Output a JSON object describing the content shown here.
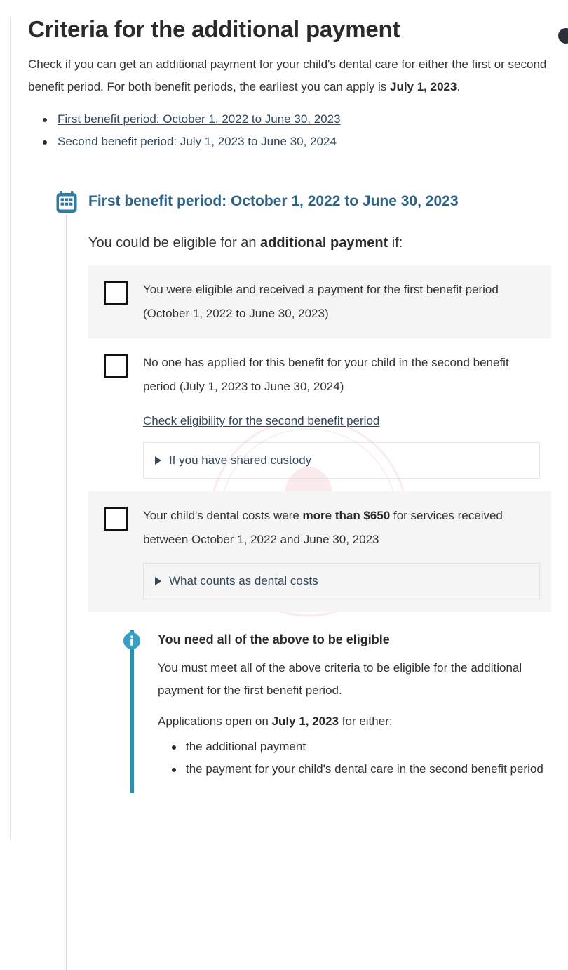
{
  "page": {
    "title": "Criteria for the additional payment",
    "intro": {
      "part1": "Check if you can get an additional payment for your child's dental care for either the first or second benefit period. For both benefit periods, the earliest you can apply is ",
      "emphasis": "July 1, 2023",
      "part2": "."
    },
    "intro_links": [
      {
        "label": "First benefit period: October 1, 2022 to June 30, 2023"
      },
      {
        "label": "Second benefit period: July 1, 2023 to June 30, 2024"
      }
    ]
  },
  "period_section": {
    "icon": "calendar-icon",
    "heading": "First benefit period: October 1, 2022 to June 30, 2023",
    "lead": {
      "part1": "You could be eligible for an ",
      "emphasis": "additional payment",
      "part2": " if:"
    },
    "criteria": [
      {
        "striped": true,
        "text_part1": "You were eligible and received a payment for the first benefit period (October 1, 2022 to June 30, 2023)",
        "emphasis": "",
        "text_part2": "",
        "link": null,
        "details": null
      },
      {
        "striped": false,
        "text_part1": "No one has applied for this benefit for your child in the second benefit period (July 1, 2023 to June 30, 2024)",
        "emphasis": "",
        "text_part2": "",
        "link": "Check eligibility for the second benefit period",
        "details": "If you have shared custody"
      },
      {
        "striped": true,
        "text_part1": "Your child's dental costs were ",
        "emphasis": "more than $650",
        "text_part2": " for services received between October 1, 2022 and June 30, 2023",
        "link": null,
        "details": "What counts as dental costs"
      }
    ]
  },
  "callout": {
    "icon": "info-icon",
    "title": "You need all of the above to be eligible",
    "paragraph1": "You must meet all of the above criteria to be eligible for the additional payment for the first benefit period.",
    "paragraph2": {
      "part1": "Applications open on ",
      "emphasis": "July 1, 2023",
      "part2": " for either:"
    },
    "items": [
      "the additional payment",
      "the payment for your child's dental care in the second benefit period"
    ]
  },
  "colors": {
    "heading_blue": "#2e6287",
    "link": "#33475b",
    "callout_border": "#2e8fb0",
    "icon_teal": "#2e7ca3",
    "stripe_bg": "#f5f5f5",
    "text": "#333333"
  }
}
